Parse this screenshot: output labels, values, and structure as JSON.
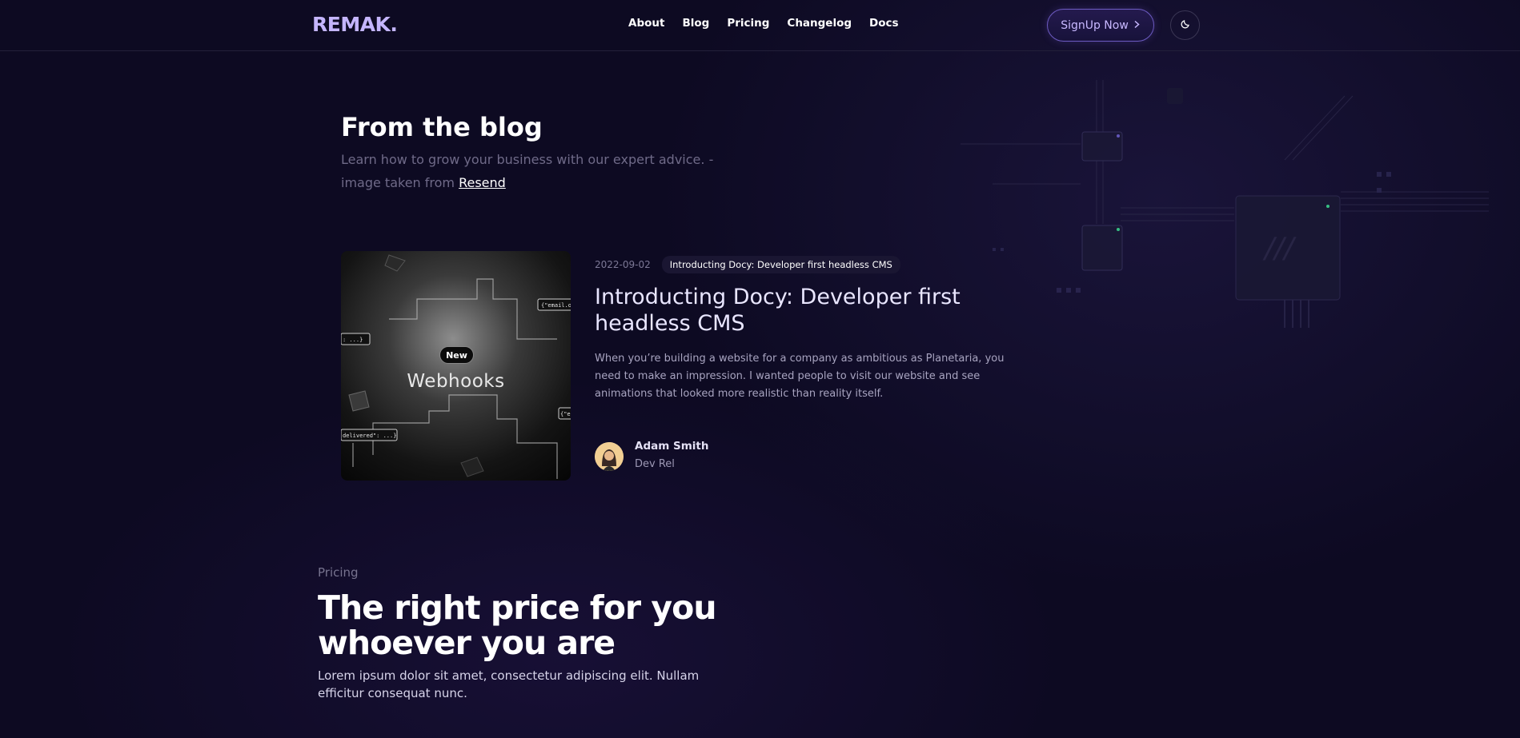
{
  "header": {
    "logo": "REMAK.",
    "nav": [
      "About",
      "Blog",
      "Pricing",
      "Changelog",
      "Docs"
    ],
    "signup_label": "SignUp Now",
    "signup_icon": "chevron-right-icon",
    "theme_icon": "moon-icon"
  },
  "blog": {
    "title": "From the blog",
    "subtitle": "Learn how to grow your business with our expert advice. - image taken from",
    "subtitle_link": "Resend"
  },
  "post": {
    "thumb_badge": "New",
    "thumb_title": "Webhooks",
    "thumb_codes": [
      "{\"email.o",
      ": ...}",
      "delivered\": ...}",
      "{\"e"
    ],
    "date": "2022-09-02",
    "tag": "Introducting Docy: Developer first headless CMS",
    "title": "Introducting Docy: Developer first headless CMS",
    "description": "When you’re building a website for a company as ambitious as Planetaria, you need to make an impression. I wanted people to visit our website and see animations that looked more realistic than reality itself.",
    "author_name": "Adam Smith",
    "author_role": "Dev Rel"
  },
  "pricing": {
    "kicker": "Pricing",
    "title": "The right price for you whoever you are",
    "description": "Lorem ipsum dolor sit amet, consectetur adipiscing elit. Nullam efficitur consequat nunc."
  },
  "colors": {
    "background": "#0d0a22",
    "accent": "#c4b5fd",
    "muted": "#6f6a88"
  }
}
